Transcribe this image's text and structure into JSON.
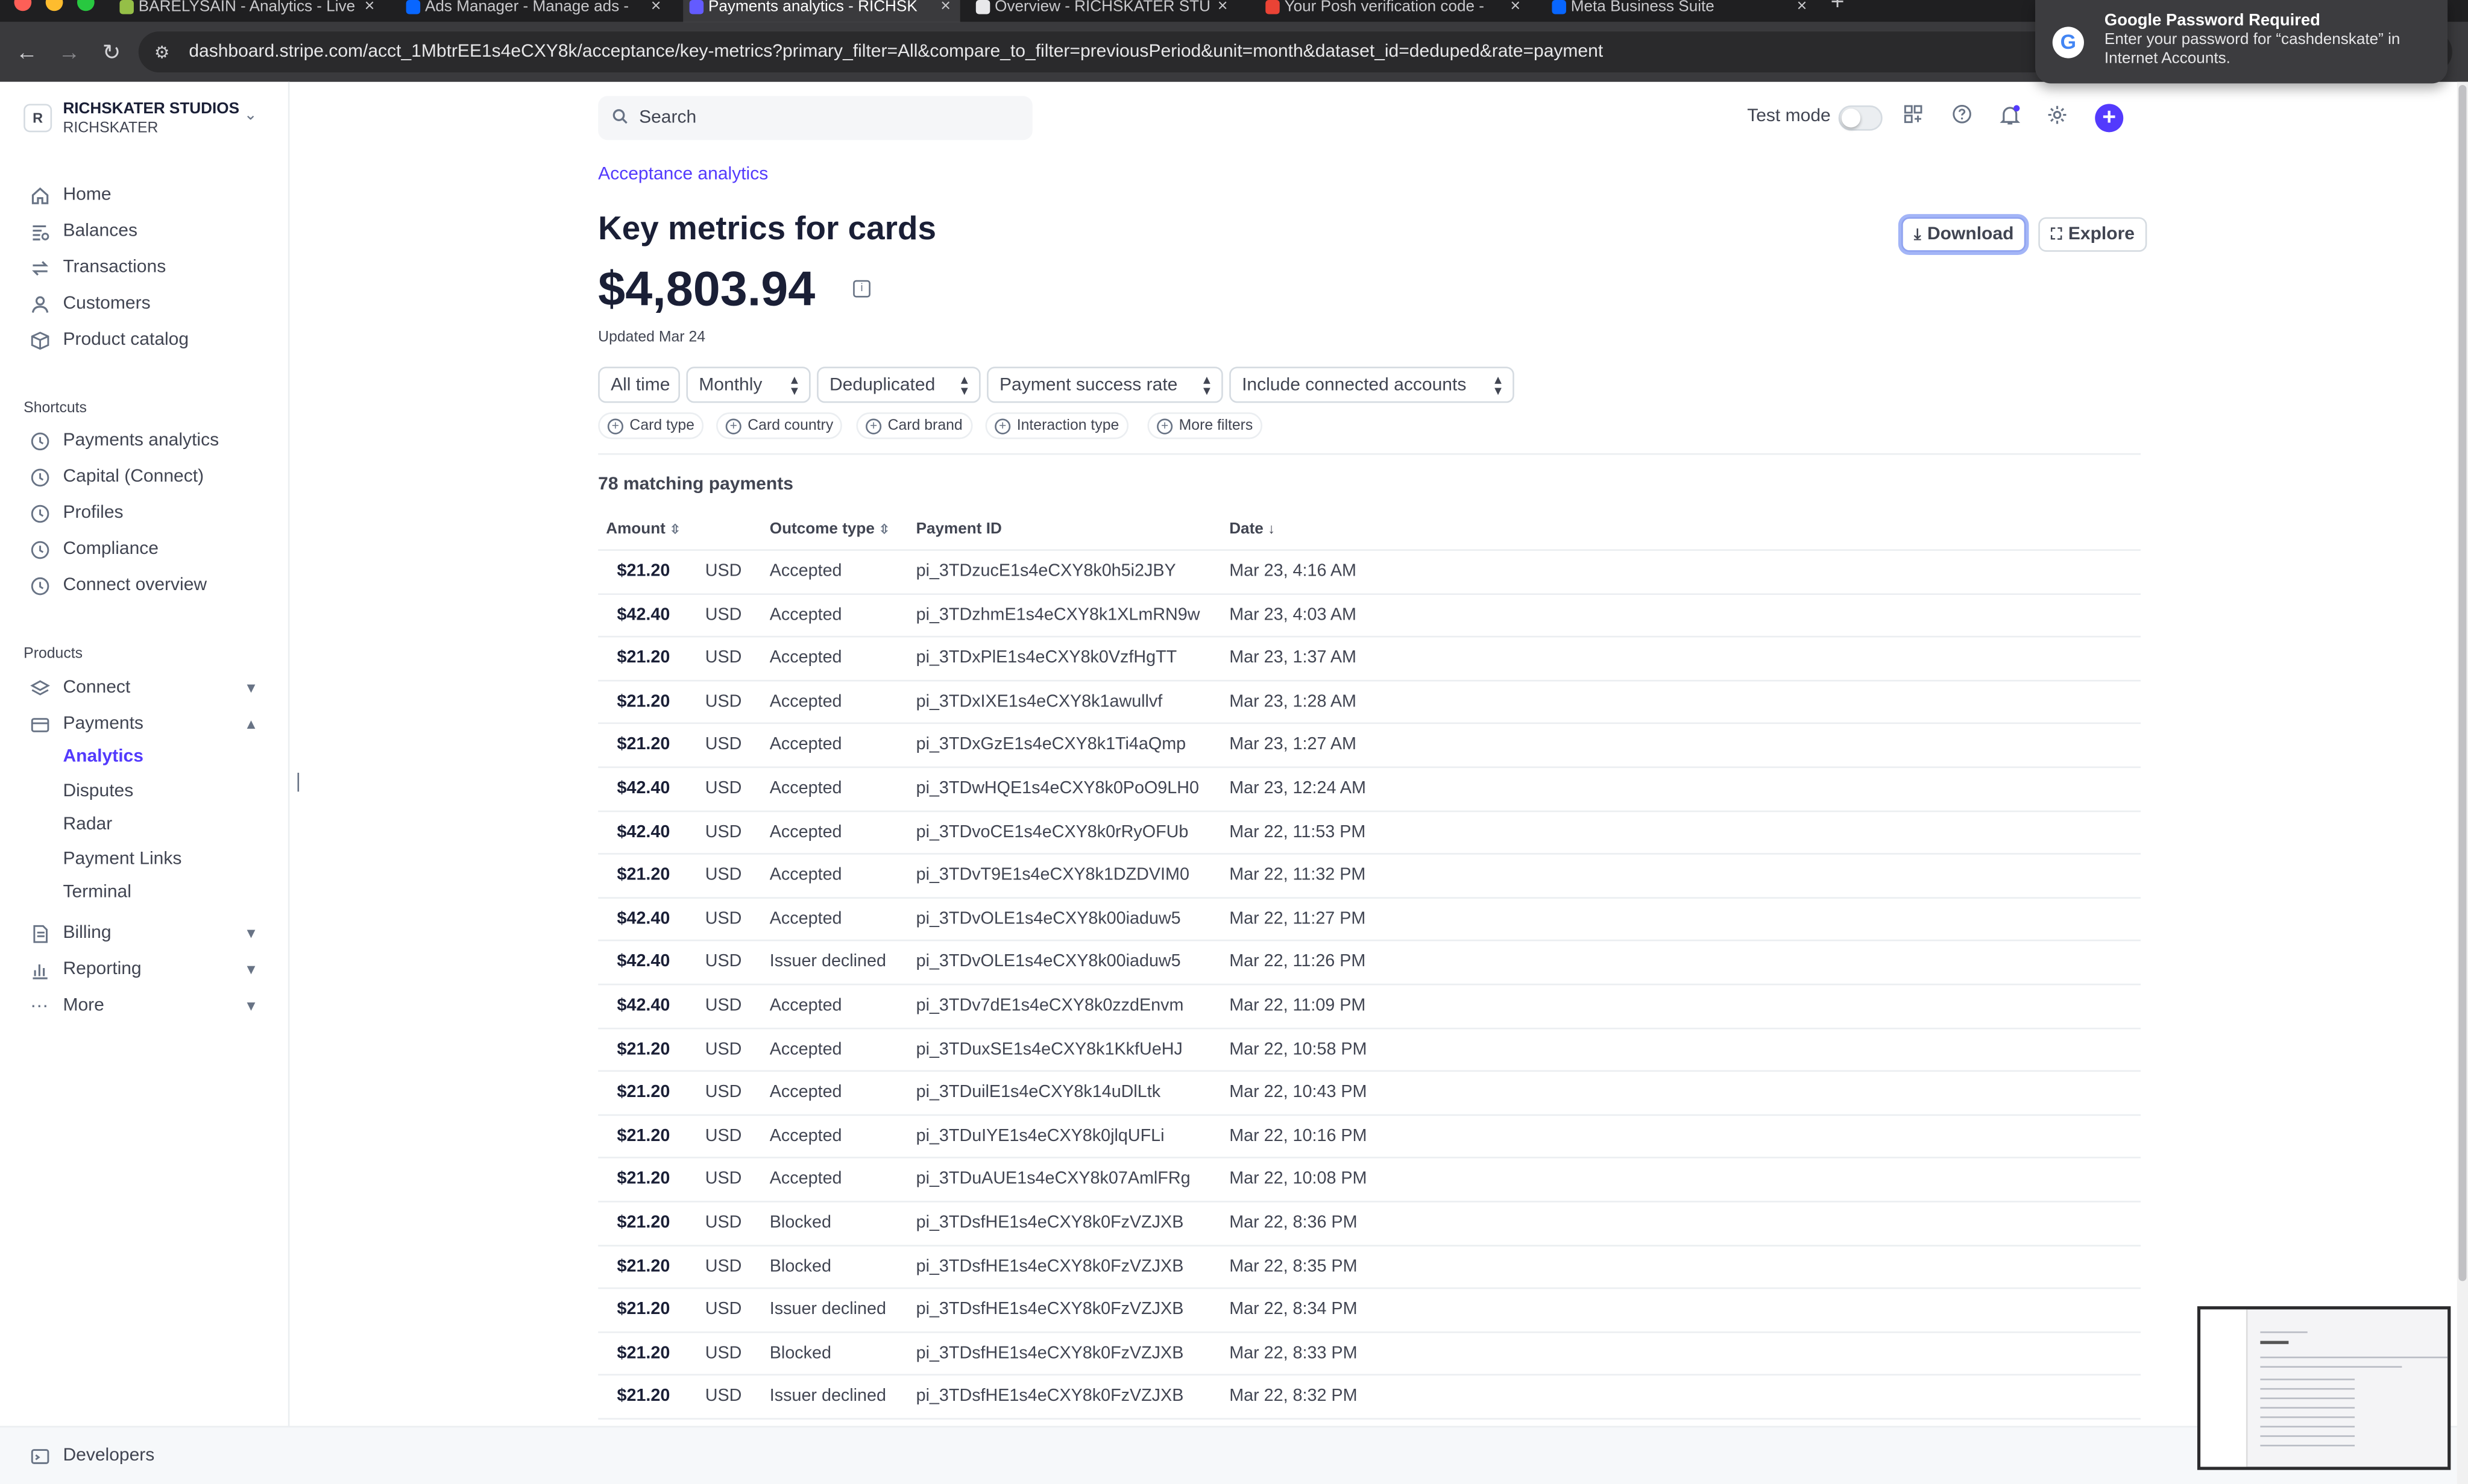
{
  "browser": {
    "tabs": [
      {
        "title": "BARELYSAIN - Analytics - Live",
        "active": false
      },
      {
        "title": "Ads Manager - Manage ads -",
        "active": false
      },
      {
        "title": "Payments analytics - RICHSK",
        "active": true
      },
      {
        "title": "Overview - RICHSKATER STU",
        "active": false
      },
      {
        "title": "Your Posh verification code -",
        "active": false
      },
      {
        "title": "Meta Business Suite",
        "active": false
      }
    ],
    "url": "dashboard.stripe.com/acct_1MbtrEE1s4eCXY8k/acceptance/key-metrics?primary_filter=All&compare_to_filter=previousPeriod&unit=month&dataset_id=deduped&rate=payment"
  },
  "account": {
    "avatar": "R",
    "name": "RICHSKATER STUDIOS",
    "sub": "RICHSKATER"
  },
  "sidebar": {
    "main_items": [
      {
        "label": "Home",
        "icon": "home-icon"
      },
      {
        "label": "Balances",
        "icon": "balances-icon"
      },
      {
        "label": "Transactions",
        "icon": "transactions-icon"
      },
      {
        "label": "Customers",
        "icon": "customers-icon"
      },
      {
        "label": "Product catalog",
        "icon": "product-catalog-icon"
      }
    ],
    "shortcuts_label": "Shortcuts",
    "shortcuts": [
      {
        "label": "Payments analytics"
      },
      {
        "label": "Capital (Connect)"
      },
      {
        "label": "Profiles"
      },
      {
        "label": "Compliance"
      },
      {
        "label": "Connect overview"
      }
    ],
    "products_label": "Products",
    "products": [
      {
        "label": "Connect",
        "icon": "connect-icon",
        "expanded": false
      },
      {
        "label": "Payments",
        "icon": "payments-icon",
        "expanded": true
      }
    ],
    "payments_sub": [
      {
        "label": "Analytics",
        "active": true
      },
      {
        "label": "Disputes",
        "active": false
      },
      {
        "label": "Radar",
        "active": false
      },
      {
        "label": "Payment Links",
        "active": false
      },
      {
        "label": "Terminal",
        "active": false
      }
    ],
    "more_products": [
      {
        "label": "Billing",
        "icon": "billing-icon"
      },
      {
        "label": "Reporting",
        "icon": "reporting-icon"
      },
      {
        "label": "More",
        "icon": "more-icon"
      }
    ],
    "developers_label": "Developers"
  },
  "header": {
    "search_placeholder": "Search",
    "test_mode_label": "Test mode",
    "test_mode_on": false
  },
  "page": {
    "breadcrumb": "Acceptance analytics",
    "title": "Key metrics for cards",
    "total": "$4,803.94",
    "updated": "Updated Mar 24",
    "download_label": "Download",
    "explore_label": "Explore",
    "filters": [
      "All time",
      "Monthly",
      "Deduplicated",
      "Payment success rate",
      "Include connected accounts"
    ],
    "pills": [
      "Card type",
      "Card country",
      "Card brand",
      "Interaction type",
      "More filters"
    ],
    "matching": "78 matching payments"
  },
  "table": {
    "headers": {
      "amount": "Amount",
      "outcome": "Outcome type",
      "payment_id": "Payment ID",
      "date": "Date"
    },
    "rows": [
      {
        "amount": "$21.20",
        "currency": "USD",
        "outcome": "Accepted",
        "id": "pi_3TDzucE1s4eCXY8k0h5i2JBY",
        "date": "Mar 23, 4:16 AM"
      },
      {
        "amount": "$42.40",
        "currency": "USD",
        "outcome": "Accepted",
        "id": "pi_3TDzhmE1s4eCXY8k1XLmRN9w",
        "date": "Mar 23, 4:03 AM"
      },
      {
        "amount": "$21.20",
        "currency": "USD",
        "outcome": "Accepted",
        "id": "pi_3TDxPlE1s4eCXY8k0VzfHgTT",
        "date": "Mar 23, 1:37 AM"
      },
      {
        "amount": "$21.20",
        "currency": "USD",
        "outcome": "Accepted",
        "id": "pi_3TDxIXE1s4eCXY8k1awullvf",
        "date": "Mar 23, 1:28 AM"
      },
      {
        "amount": "$21.20",
        "currency": "USD",
        "outcome": "Accepted",
        "id": "pi_3TDxGzE1s4eCXY8k1Ti4aQmp",
        "date": "Mar 23, 1:27 AM"
      },
      {
        "amount": "$42.40",
        "currency": "USD",
        "outcome": "Accepted",
        "id": "pi_3TDwHQE1s4eCXY8k0PoO9LH0",
        "date": "Mar 23, 12:24 AM"
      },
      {
        "amount": "$42.40",
        "currency": "USD",
        "outcome": "Accepted",
        "id": "pi_3TDvoCE1s4eCXY8k0rRyOFUb",
        "date": "Mar 22, 11:53 PM"
      },
      {
        "amount": "$21.20",
        "currency": "USD",
        "outcome": "Accepted",
        "id": "pi_3TDvT9E1s4eCXY8k1DZDVIM0",
        "date": "Mar 22, 11:32 PM"
      },
      {
        "amount": "$42.40",
        "currency": "USD",
        "outcome": "Accepted",
        "id": "pi_3TDvOLE1s4eCXY8k00iaduw5",
        "date": "Mar 22, 11:27 PM"
      },
      {
        "amount": "$42.40",
        "currency": "USD",
        "outcome": "Issuer declined",
        "id": "pi_3TDvOLE1s4eCXY8k00iaduw5",
        "date": "Mar 22, 11:26 PM"
      },
      {
        "amount": "$42.40",
        "currency": "USD",
        "outcome": "Accepted",
        "id": "pi_3TDv7dE1s4eCXY8k0zzdEnvm",
        "date": "Mar 22, 11:09 PM"
      },
      {
        "amount": "$21.20",
        "currency": "USD",
        "outcome": "Accepted",
        "id": "pi_3TDuxSE1s4eCXY8k1KkfUeHJ",
        "date": "Mar 22, 10:58 PM"
      },
      {
        "amount": "$21.20",
        "currency": "USD",
        "outcome": "Accepted",
        "id": "pi_3TDuilE1s4eCXY8k14uDlLtk",
        "date": "Mar 22, 10:43 PM"
      },
      {
        "amount": "$21.20",
        "currency": "USD",
        "outcome": "Accepted",
        "id": "pi_3TDuIYE1s4eCXY8k0jlqUFLi",
        "date": "Mar 22, 10:16 PM"
      },
      {
        "amount": "$21.20",
        "currency": "USD",
        "outcome": "Accepted",
        "id": "pi_3TDuAUE1s4eCXY8k07AmlFRg",
        "date": "Mar 22, 10:08 PM"
      },
      {
        "amount": "$21.20",
        "currency": "USD",
        "outcome": "Blocked",
        "id": "pi_3TDsfHE1s4eCXY8k0FzVZJXB",
        "date": "Mar 22, 8:36 PM"
      },
      {
        "amount": "$21.20",
        "currency": "USD",
        "outcome": "Blocked",
        "id": "pi_3TDsfHE1s4eCXY8k0FzVZJXB",
        "date": "Mar 22, 8:35 PM"
      },
      {
        "amount": "$21.20",
        "currency": "USD",
        "outcome": "Issuer declined",
        "id": "pi_3TDsfHE1s4eCXY8k0FzVZJXB",
        "date": "Mar 22, 8:34 PM"
      },
      {
        "amount": "$21.20",
        "currency": "USD",
        "outcome": "Blocked",
        "id": "pi_3TDsfHE1s4eCXY8k0FzVZJXB",
        "date": "Mar 22, 8:33 PM"
      },
      {
        "amount": "$21.20",
        "currency": "USD",
        "outcome": "Issuer declined",
        "id": "pi_3TDsfHE1s4eCXY8k0FzVZJXB",
        "date": "Mar 22, 8:32 PM"
      }
    ]
  },
  "password_popup": {
    "title": "Google Password Required",
    "body": "Enter your password for “cashdenskate” in Internet Accounts."
  },
  "colors": {
    "accent": "#533afd",
    "text": "#1a1f36",
    "muted": "#414552",
    "border": "#ebeef1"
  }
}
